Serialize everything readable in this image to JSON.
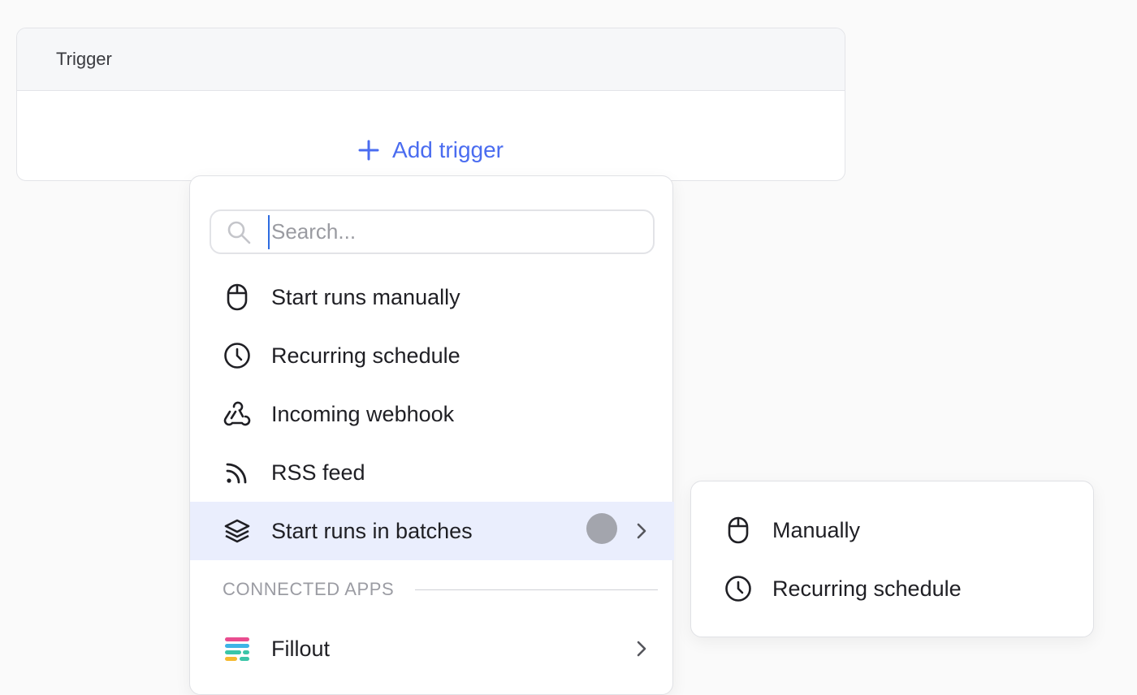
{
  "trigger_card": {
    "title": "Trigger",
    "add_label": "Add trigger"
  },
  "dropdown": {
    "search": {
      "placeholder": "Search...",
      "value": ""
    },
    "items": [
      {
        "label": "Start runs manually",
        "icon": "mouse-icon"
      },
      {
        "label": "Recurring schedule",
        "icon": "clock-icon"
      },
      {
        "label": "Incoming webhook",
        "icon": "webhook-icon"
      },
      {
        "label": "RSS feed",
        "icon": "rss-icon"
      },
      {
        "label": "Start runs in batches",
        "icon": "layers-icon",
        "active": true,
        "has_submenu": true
      }
    ],
    "section_label": "CONNECTED APPS",
    "apps": [
      {
        "label": "Fillout",
        "icon": "fillout-logo-icon",
        "has_submenu": true
      }
    ]
  },
  "submenu": {
    "items": [
      {
        "label": "Manually",
        "icon": "mouse-icon"
      },
      {
        "label": "Recurring schedule",
        "icon": "clock-icon"
      }
    ]
  },
  "colors": {
    "accent": "#4a6cf0",
    "active_bg": "#eaeefd",
    "page_bg": "#fafafa",
    "loading_dot": "#a3a5ad"
  }
}
